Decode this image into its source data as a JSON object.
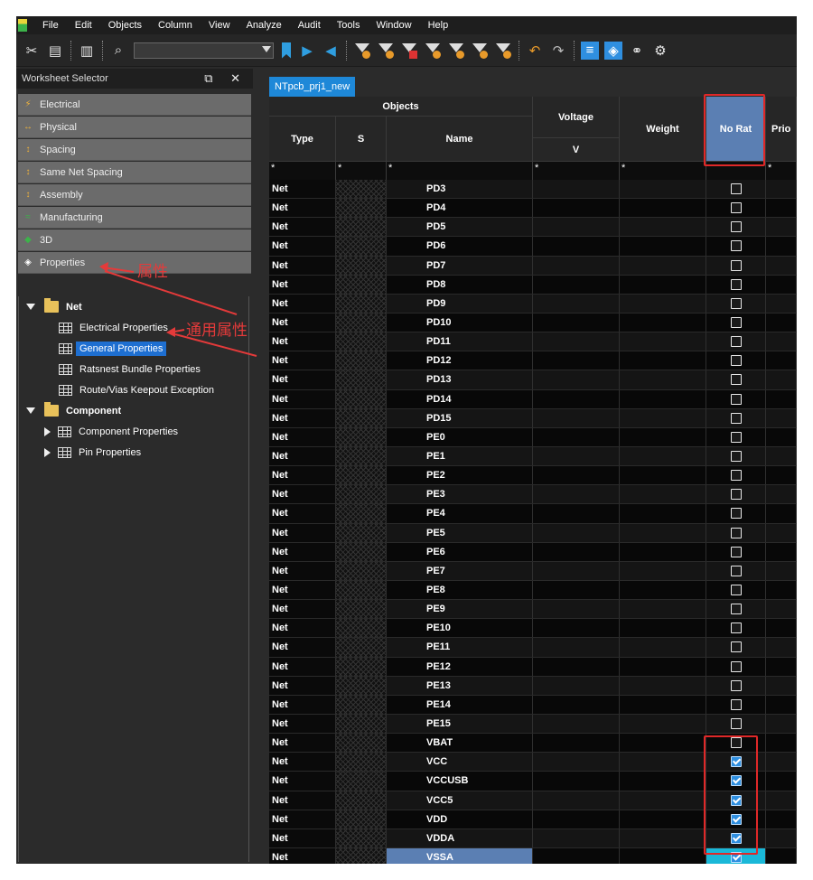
{
  "menu": [
    "File",
    "Edit",
    "Objects",
    "Column",
    "View",
    "Analyze",
    "Audit",
    "Tools",
    "Window",
    "Help"
  ],
  "toolbar": {
    "combo_value": "",
    "icons": [
      "cut-icon",
      "copy-icon",
      "paste-icon",
      "find-icon"
    ]
  },
  "worksheet_selector": {
    "title": "Worksheet Selector",
    "controls": "⧉ ✕",
    "categories": [
      {
        "label": "Electrical",
        "icon": "⚡"
      },
      {
        "label": "Physical",
        "icon": "↔"
      },
      {
        "label": "Spacing",
        "icon": "↕"
      },
      {
        "label": "Same Net Spacing",
        "icon": "↕"
      },
      {
        "label": "Assembly",
        "icon": "↕"
      },
      {
        "label": "Manufacturing",
        "icon": "≈"
      },
      {
        "label": "3D",
        "icon": "◆"
      },
      {
        "label": "Properties",
        "icon": "◈"
      }
    ],
    "tree": {
      "net": "Net",
      "net_children": [
        "Electrical Properties",
        "General Properties",
        "Ratsnest Bundle Properties",
        "Route/Vias Keepout Exception"
      ],
      "component": "Component",
      "component_children": [
        "Component Properties",
        "Pin Properties"
      ]
    }
  },
  "annotations": {
    "properties_cn": "属性",
    "general_cn": "通用属性"
  },
  "sheet": {
    "tab_label": "NTpcb_prj1_new",
    "headers": {
      "objects": "Objects",
      "type": "Type",
      "s": "S",
      "name": "Name",
      "voltage": "Voltage",
      "voltage_unit": "V",
      "weight": "Weight",
      "no_rat": "No Rat",
      "priority": "Prio"
    },
    "filter_star": "*",
    "rows": [
      {
        "type": "Net",
        "name": "PD3",
        "no_rat": false
      },
      {
        "type": "Net",
        "name": "PD4",
        "no_rat": false
      },
      {
        "type": "Net",
        "name": "PD5",
        "no_rat": false
      },
      {
        "type": "Net",
        "name": "PD6",
        "no_rat": false
      },
      {
        "type": "Net",
        "name": "PD7",
        "no_rat": false
      },
      {
        "type": "Net",
        "name": "PD8",
        "no_rat": false
      },
      {
        "type": "Net",
        "name": "PD9",
        "no_rat": false
      },
      {
        "type": "Net",
        "name": "PD10",
        "no_rat": false
      },
      {
        "type": "Net",
        "name": "PD11",
        "no_rat": false
      },
      {
        "type": "Net",
        "name": "PD12",
        "no_rat": false
      },
      {
        "type": "Net",
        "name": "PD13",
        "no_rat": false
      },
      {
        "type": "Net",
        "name": "PD14",
        "no_rat": false
      },
      {
        "type": "Net",
        "name": "PD15",
        "no_rat": false
      },
      {
        "type": "Net",
        "name": "PE0",
        "no_rat": false
      },
      {
        "type": "Net",
        "name": "PE1",
        "no_rat": false
      },
      {
        "type": "Net",
        "name": "PE2",
        "no_rat": false
      },
      {
        "type": "Net",
        "name": "PE3",
        "no_rat": false
      },
      {
        "type": "Net",
        "name": "PE4",
        "no_rat": false
      },
      {
        "type": "Net",
        "name": "PE5",
        "no_rat": false
      },
      {
        "type": "Net",
        "name": "PE6",
        "no_rat": false
      },
      {
        "type": "Net",
        "name": "PE7",
        "no_rat": false
      },
      {
        "type": "Net",
        "name": "PE8",
        "no_rat": false
      },
      {
        "type": "Net",
        "name": "PE9",
        "no_rat": false
      },
      {
        "type": "Net",
        "name": "PE10",
        "no_rat": false
      },
      {
        "type": "Net",
        "name": "PE11",
        "no_rat": false
      },
      {
        "type": "Net",
        "name": "PE12",
        "no_rat": false
      },
      {
        "type": "Net",
        "name": "PE13",
        "no_rat": false
      },
      {
        "type": "Net",
        "name": "PE14",
        "no_rat": false
      },
      {
        "type": "Net",
        "name": "PE15",
        "no_rat": false
      },
      {
        "type": "Net",
        "name": "VBAT",
        "no_rat": false
      },
      {
        "type": "Net",
        "name": "VCC",
        "no_rat": true
      },
      {
        "type": "Net",
        "name": "VCCUSB",
        "no_rat": true
      },
      {
        "type": "Net",
        "name": "VCC5",
        "no_rat": true
      },
      {
        "type": "Net",
        "name": "VDD",
        "no_rat": true
      },
      {
        "type": "Net",
        "name": "VDDA",
        "no_rat": true
      },
      {
        "type": "Net",
        "name": "VSSA",
        "no_rat": true
      }
    ]
  },
  "colors": {
    "highlight_red": "#e02828",
    "selection_blue": "#1e6fd1",
    "no_rat_header": "#5b7fb3"
  }
}
